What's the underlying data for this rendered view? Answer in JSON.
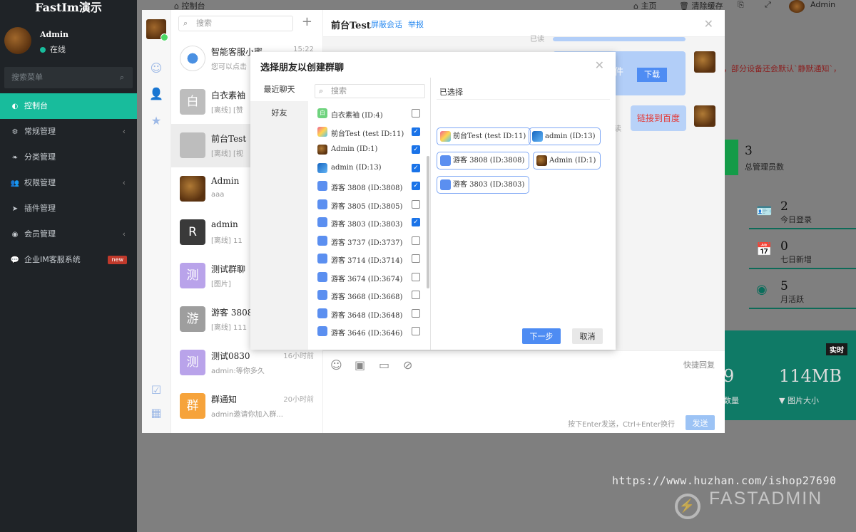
{
  "admin": {
    "logo": "FastIm演示",
    "user_name": "Admin",
    "user_status": "在线",
    "search_placeholder": "搜索菜单",
    "menu": [
      {
        "label": "控制台",
        "icon": "dashboard-icon",
        "active": true
      },
      {
        "label": "常规管理",
        "icon": "cogs-icon",
        "arrow": "‹"
      },
      {
        "label": "分类管理",
        "icon": "leaf-icon"
      },
      {
        "label": "权限管理",
        "icon": "group-icon",
        "arrow": "‹"
      },
      {
        "label": "插件管理",
        "icon": "rocket-icon"
      },
      {
        "label": "会员管理",
        "icon": "user-circle-icon",
        "arrow": "‹"
      },
      {
        "label": "企业IM客服系统",
        "icon": "comment-icon",
        "badge": "new"
      }
    ],
    "top_tab": "控制台",
    "top_right": {
      "home": "主页",
      "clear_cache": "清除缓存",
      "admin": "Admin"
    },
    "notice_fragment": "，部分设备还会默认`静默通知`，",
    "stats": [
      {
        "num": "3",
        "label": "总管理员数"
      },
      {
        "num": "2",
        "label": "今日登录"
      },
      {
        "num": "0",
        "label": "七日新增"
      },
      {
        "num": "5",
        "label": "月活跃"
      }
    ],
    "realtime_badge": "实时",
    "big_num_left": "9",
    "big_num": "114MB",
    "big_label_left": "数量",
    "big_label": "图片大小",
    "watermark_url": "https://www.huzhan.com/ishop27690",
    "watermark_brand": "FASTADMIN"
  },
  "im": {
    "search_placeholder": "搜索",
    "conversations": [
      {
        "name": "智能客服小蜜",
        "sub": "您可以点击",
        "time": "15:22",
        "avatar": "bot",
        "avatar_text": ""
      },
      {
        "name": "白衣素袖",
        "sub": "[离线] [赞",
        "time": "",
        "avatar": "gray",
        "avatar_text": "白"
      },
      {
        "name": "前台Test",
        "sub": "[离线] [视",
        "time": "",
        "avatar": "gray",
        "avatar_text": "",
        "selected": true
      },
      {
        "name": "Admin",
        "sub": "aaa",
        "time": "",
        "avatar": "brown",
        "avatar_text": ""
      },
      {
        "name": "admin",
        "sub": "[离线] 11",
        "time": "",
        "avatar": "dark",
        "avatar_text": "R"
      },
      {
        "name": "测试群聊",
        "sub": "[图片]",
        "time": "",
        "avatar": "purple",
        "avatar_text": "测"
      },
      {
        "name": "游客 3808",
        "sub": "[离线] 111",
        "time": "",
        "avatar": "dgray",
        "avatar_text": "游"
      },
      {
        "name": "测试0830",
        "sub": "admin:等你多久",
        "time": "16小时前",
        "avatar": "purple",
        "avatar_text": "测"
      },
      {
        "name": "群通知",
        "sub": "admin邀请你加入群...",
        "time": "20小时前",
        "avatar": "orange",
        "avatar_text": "群"
      }
    ],
    "chat": {
      "title": "前台Test",
      "block_link": "屏蔽会话",
      "report_link": "举报",
      "read_mark_1": "已读",
      "read_mark_2": "读",
      "file_fragment": "件",
      "download_label": "下载",
      "link_message": "链接到百度",
      "quick_reply": "快捷回复",
      "send_hint": "按下Enter发送，Ctrl+Enter换行",
      "send_label": "发送"
    }
  },
  "dialog": {
    "title": "选择朋友以创建群聊",
    "tabs": [
      "最近聊天",
      "好友"
    ],
    "search_placeholder": "搜索",
    "selected_title": "已选择",
    "friends": [
      {
        "name": "白衣素袖 (ID:4)",
        "avatar": "green",
        "avatar_text": "白",
        "checked": false
      },
      {
        "name": "前台Test (test ID:11)",
        "avatar": "multi",
        "avatar_text": "",
        "checked": true
      },
      {
        "name": "Admin (ID:1)",
        "avatar": "brown",
        "avatar_text": "",
        "checked": true
      },
      {
        "name": "admin (ID:13)",
        "avatar": "line",
        "avatar_text": "",
        "checked": true
      },
      {
        "name": "游客 3808 (ID:3808)",
        "avatar": "blue",
        "avatar_text": "",
        "checked": true
      },
      {
        "name": "游客 3805 (ID:3805)",
        "avatar": "blue",
        "avatar_text": "",
        "checked": false
      },
      {
        "name": "游客 3803 (ID:3803)",
        "avatar": "blue",
        "avatar_text": "",
        "checked": true
      },
      {
        "name": "游客 3737 (ID:3737)",
        "avatar": "blue",
        "avatar_text": "",
        "checked": false
      },
      {
        "name": "游客 3714 (ID:3714)",
        "avatar": "blue",
        "avatar_text": "",
        "checked": false
      },
      {
        "name": "游客 3674 (ID:3674)",
        "avatar": "blue",
        "avatar_text": "",
        "checked": false
      },
      {
        "name": "游客 3668 (ID:3668)",
        "avatar": "blue",
        "avatar_text": "",
        "checked": false
      },
      {
        "name": "游客 3648 (ID:3648)",
        "avatar": "blue",
        "avatar_text": "",
        "checked": false
      },
      {
        "name": "游客 3646 (ID:3646)",
        "avatar": "blue",
        "avatar_text": "",
        "checked": false
      }
    ],
    "selected": [
      {
        "name": "前台Test (test ID:11)",
        "avatar": "multi"
      },
      {
        "name": "admin (ID:13)",
        "avatar": "line"
      },
      {
        "name": "游客 3808 (ID:3808)",
        "avatar": "blue"
      },
      {
        "name": "Admin (ID:1)",
        "avatar": "brown"
      },
      {
        "name": "游客 3803 (ID:3803)",
        "avatar": "blue"
      }
    ],
    "next_label": "下一步",
    "cancel_label": "取消"
  },
  "colors": {
    "accent": "#18bc9c",
    "primary": "#4e8cf3",
    "sidebar": "#1f2327"
  }
}
